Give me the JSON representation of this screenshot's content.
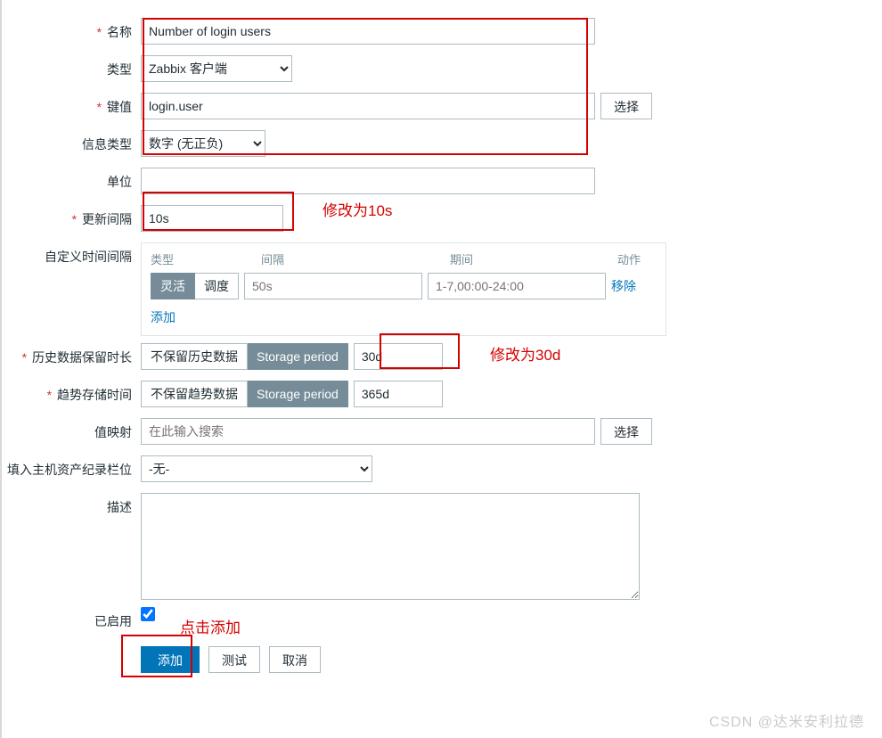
{
  "labels": {
    "name": "名称",
    "type": "类型",
    "key": "键值",
    "infoType": "信息类型",
    "units": "单位",
    "updateInterval": "更新间隔",
    "customIntervals": "自定义时间间隔",
    "historyPeriod": "历史数据保留时长",
    "trendPeriod": "趋势存储时间",
    "valueMapping": "值映射",
    "hostInventory": "填入主机资产纪录栏位",
    "description": "描述",
    "enabled": "已启用"
  },
  "values": {
    "name": "Number of login users",
    "type": "Zabbix 客户端",
    "key": "login.user",
    "infoType": "数字 (无正负)",
    "units": "",
    "updateInterval": "10s",
    "historyValue": "30d",
    "trendValue": "365d",
    "hostInventory": "-无-",
    "description": "",
    "valueMappingPlaceholder": "在此输入搜索"
  },
  "custom": {
    "headers": {
      "type": "类型",
      "interval": "间隔",
      "period": "期间",
      "action": "动作"
    },
    "seg": {
      "flexible": "灵活",
      "schedule": "调度"
    },
    "intervalPlaceholder": "50s",
    "periodPlaceholder": "1-7,00:00-24:00",
    "remove": "移除",
    "add": "添加"
  },
  "segments": {
    "noHistory": "不保留历史数据",
    "noTrend": "不保留趋势数据",
    "storagePeriod": "Storage period"
  },
  "buttons": {
    "select": "选择",
    "add": "添加",
    "test": "测试",
    "cancel": "取消"
  },
  "annotations": {
    "updateTo10s": "修改为10s",
    "updateTo30d": "修改为30d",
    "clickAdd": "点击添加"
  },
  "watermark": "CSDN @达米安利拉德"
}
